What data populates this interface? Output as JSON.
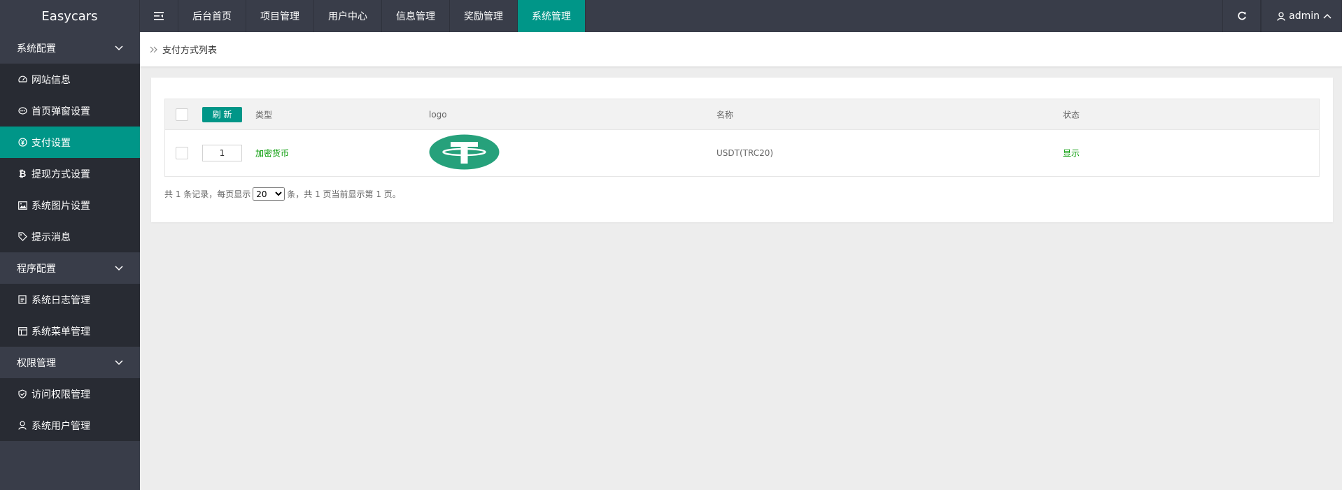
{
  "app": {
    "title": "Easycars"
  },
  "topnav": {
    "items": [
      {
        "label": "后台首页"
      },
      {
        "label": "项目管理"
      },
      {
        "label": "用户中心"
      },
      {
        "label": "信息管理"
      },
      {
        "label": "奖励管理"
      },
      {
        "label": "系统管理",
        "active": true
      }
    ],
    "user": "admin"
  },
  "sidebar": {
    "groups": [
      {
        "label": "系统配置",
        "items": [
          {
            "label": "网站信息",
            "icon": "dashboard-icon"
          },
          {
            "label": "首页弹窗设置",
            "icon": "popup-icon"
          },
          {
            "label": "支付设置",
            "icon": "yen-icon",
            "active": true
          },
          {
            "label": "提现方式设置",
            "icon": "bitcoin-icon"
          },
          {
            "label": "系统图片设置",
            "icon": "image-icon"
          },
          {
            "label": "提示消息",
            "icon": "tag-icon"
          }
        ]
      },
      {
        "label": "程序配置",
        "items": [
          {
            "label": "系统日志管理",
            "icon": "log-icon"
          },
          {
            "label": "系统菜单管理",
            "icon": "menu-icon"
          }
        ]
      },
      {
        "label": "权限管理",
        "items": [
          {
            "label": "访问权限管理",
            "icon": "shield-icon"
          },
          {
            "label": "系统用户管理",
            "icon": "user-icon"
          }
        ]
      }
    ]
  },
  "breadcrumb": {
    "label": "支付方式列表"
  },
  "table": {
    "refresh_label": "刷 新",
    "columns": {
      "type": "类型",
      "logo": "logo",
      "name": "名称",
      "status": "状态"
    },
    "rows": [
      {
        "sort": "1",
        "type": "加密货币",
        "logo": "tether-logo",
        "name": "USDT(TRC20)",
        "status": "显示"
      }
    ]
  },
  "pager": {
    "prefix": "共 1 条记录，每页显示",
    "page_size": "20",
    "suffix": "条，共 1 页当前显示第 1 页。"
  },
  "colors": {
    "accent": "#009688",
    "topbar": "#393d49",
    "sub_menu": "#282b33",
    "link_green": "#009900",
    "tether": "#26a17b"
  }
}
